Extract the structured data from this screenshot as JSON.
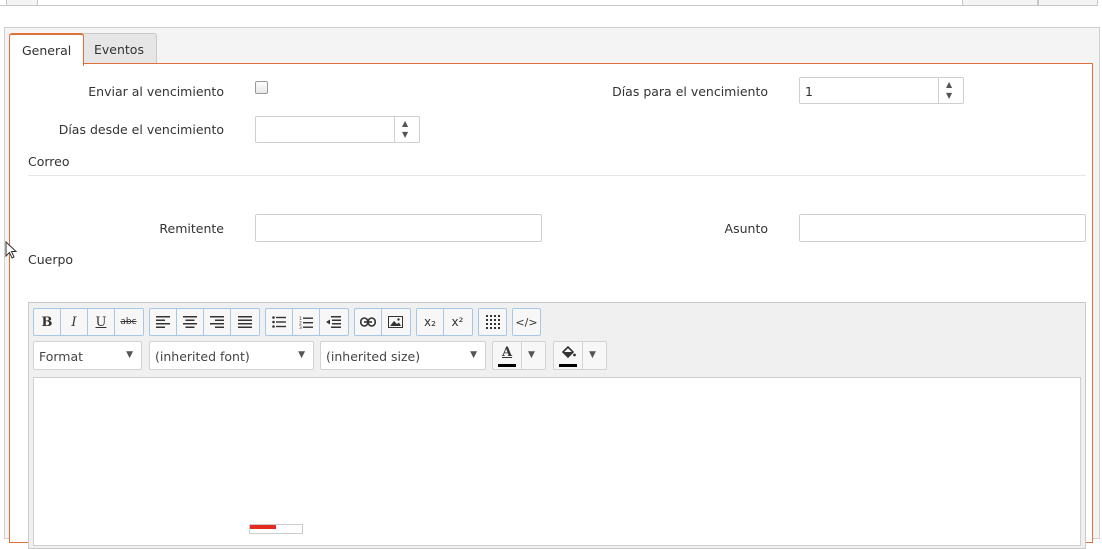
{
  "tabs": [
    {
      "label": "General",
      "active": true
    },
    {
      "label": "Eventos",
      "active": false
    }
  ],
  "form": {
    "enviar_label": "Enviar al vencimiento",
    "enviar_checked": false,
    "dias_para_label": "Días para el vencimiento",
    "dias_para_value": "1",
    "dias_desde_label": "Días desde el vencimiento",
    "dias_desde_value": "",
    "correo_label": "Correo",
    "remitente_label": "Remitente",
    "remitente_value": "",
    "asunto_label": "Asunto",
    "asunto_value": "",
    "cuerpo_label": "Cuerpo"
  },
  "editor": {
    "format_label": "Format",
    "font_label": "(inherited font)",
    "size_label": "(inherited size)",
    "buttons": {
      "bold": "B",
      "italic": "I",
      "underline": "U",
      "strike": "abc",
      "subscript": "x₂",
      "superscript": "x²",
      "source": "</>"
    },
    "icons": [
      "align-left-icon",
      "align-center-icon",
      "align-right-icon",
      "align-justify-icon",
      "bulleted-list-icon",
      "numbered-list-icon",
      "outdent-icon",
      "link-icon",
      "image-icon",
      "table-icon",
      "text-color-icon",
      "background-color-icon"
    ],
    "content": ""
  },
  "colors": {
    "accent": "#e0703a",
    "toolbar_border": "#a6c8e6",
    "toggle_on": "#e32b1f"
  }
}
